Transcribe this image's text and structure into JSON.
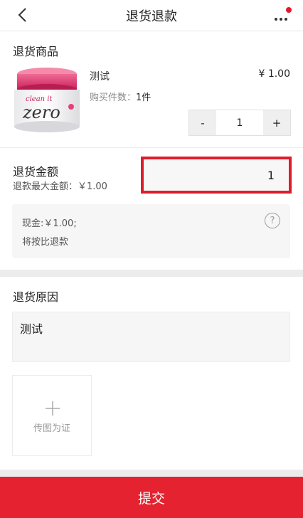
{
  "header": {
    "title": "退货退款",
    "back_icon": "chevron-left-icon",
    "more_icon": "more-dots-icon",
    "notify_color": "#e21b2b"
  },
  "product_section": {
    "title": "退货商品",
    "product": {
      "name": "测试",
      "price": "¥ 1.00",
      "purchase_label": "购买件数：",
      "purchase_count": "1件",
      "image_brand_text": "clean it zero"
    },
    "stepper": {
      "minus": "-",
      "value": "1",
      "plus": "+"
    }
  },
  "refund_amount": {
    "title": "退货金额",
    "max_label": "退款最大金额：￥1.00",
    "input_value": "1",
    "info_cash": "现金:￥1.00;",
    "info_ratio": "将按比退款",
    "help_icon": "question-circle-icon"
  },
  "reason": {
    "title": "退货原因",
    "text": "测试"
  },
  "upload": {
    "icon": "plus-icon",
    "label": "传图为证"
  },
  "submit": {
    "label": "提交",
    "color": "#e5222f"
  }
}
